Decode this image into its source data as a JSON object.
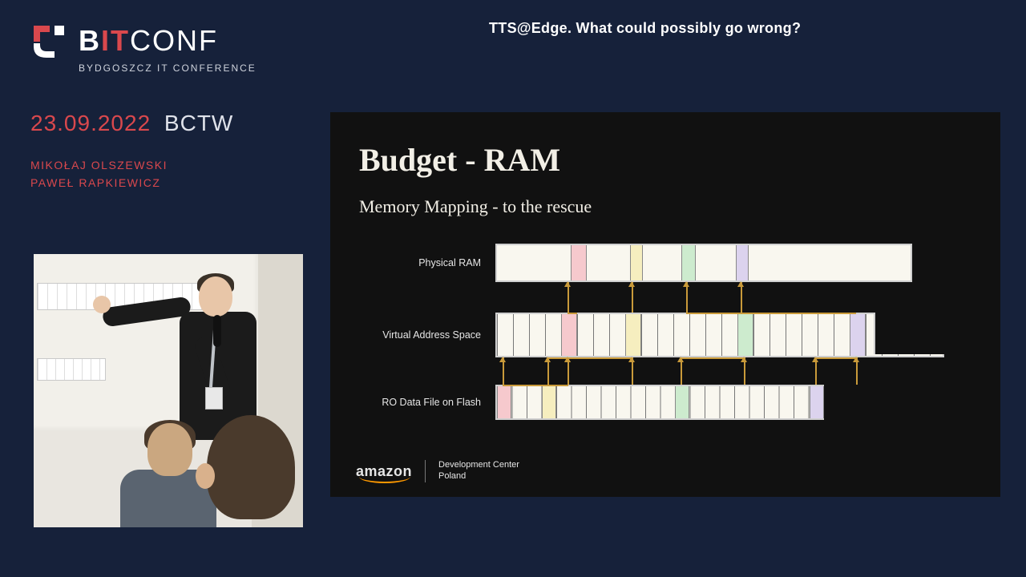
{
  "header": {
    "talk_title": "TTS@Edge.  What could possibly go wrong?"
  },
  "logo": {
    "word_b": "B",
    "word_it": "IT",
    "word_conf": "CONF",
    "subtitle": "BYDGOSZCZ IT CONFERENCE"
  },
  "event": {
    "date": "23.09.2022",
    "venue": "BCTW"
  },
  "speakers": {
    "line1": "MIKOŁAJ OLSZEWSKI",
    "line2": "PAWEŁ RAPKIEWICZ"
  },
  "slide": {
    "title": "Budget - RAM",
    "subtitle": "Memory Mapping - to the rescue",
    "rows": {
      "physical_ram": "Physical RAM",
      "virtual_address_space": "Virtual Address Space",
      "ro_data_file": "RO Data File on Flash"
    },
    "footer": {
      "company": "amazon",
      "dept_line1": "Development Center",
      "dept_line2": "Poland"
    }
  },
  "colors": {
    "accent_red": "#d9484d",
    "bg_navy": "#16213a",
    "slide_bg": "#111111",
    "arrow": "#c99a3a",
    "seg_pink": "#f6c9cd",
    "seg_yellow": "#f6eebf",
    "seg_green": "#cdebce",
    "seg_purple": "#dcd3ee"
  }
}
